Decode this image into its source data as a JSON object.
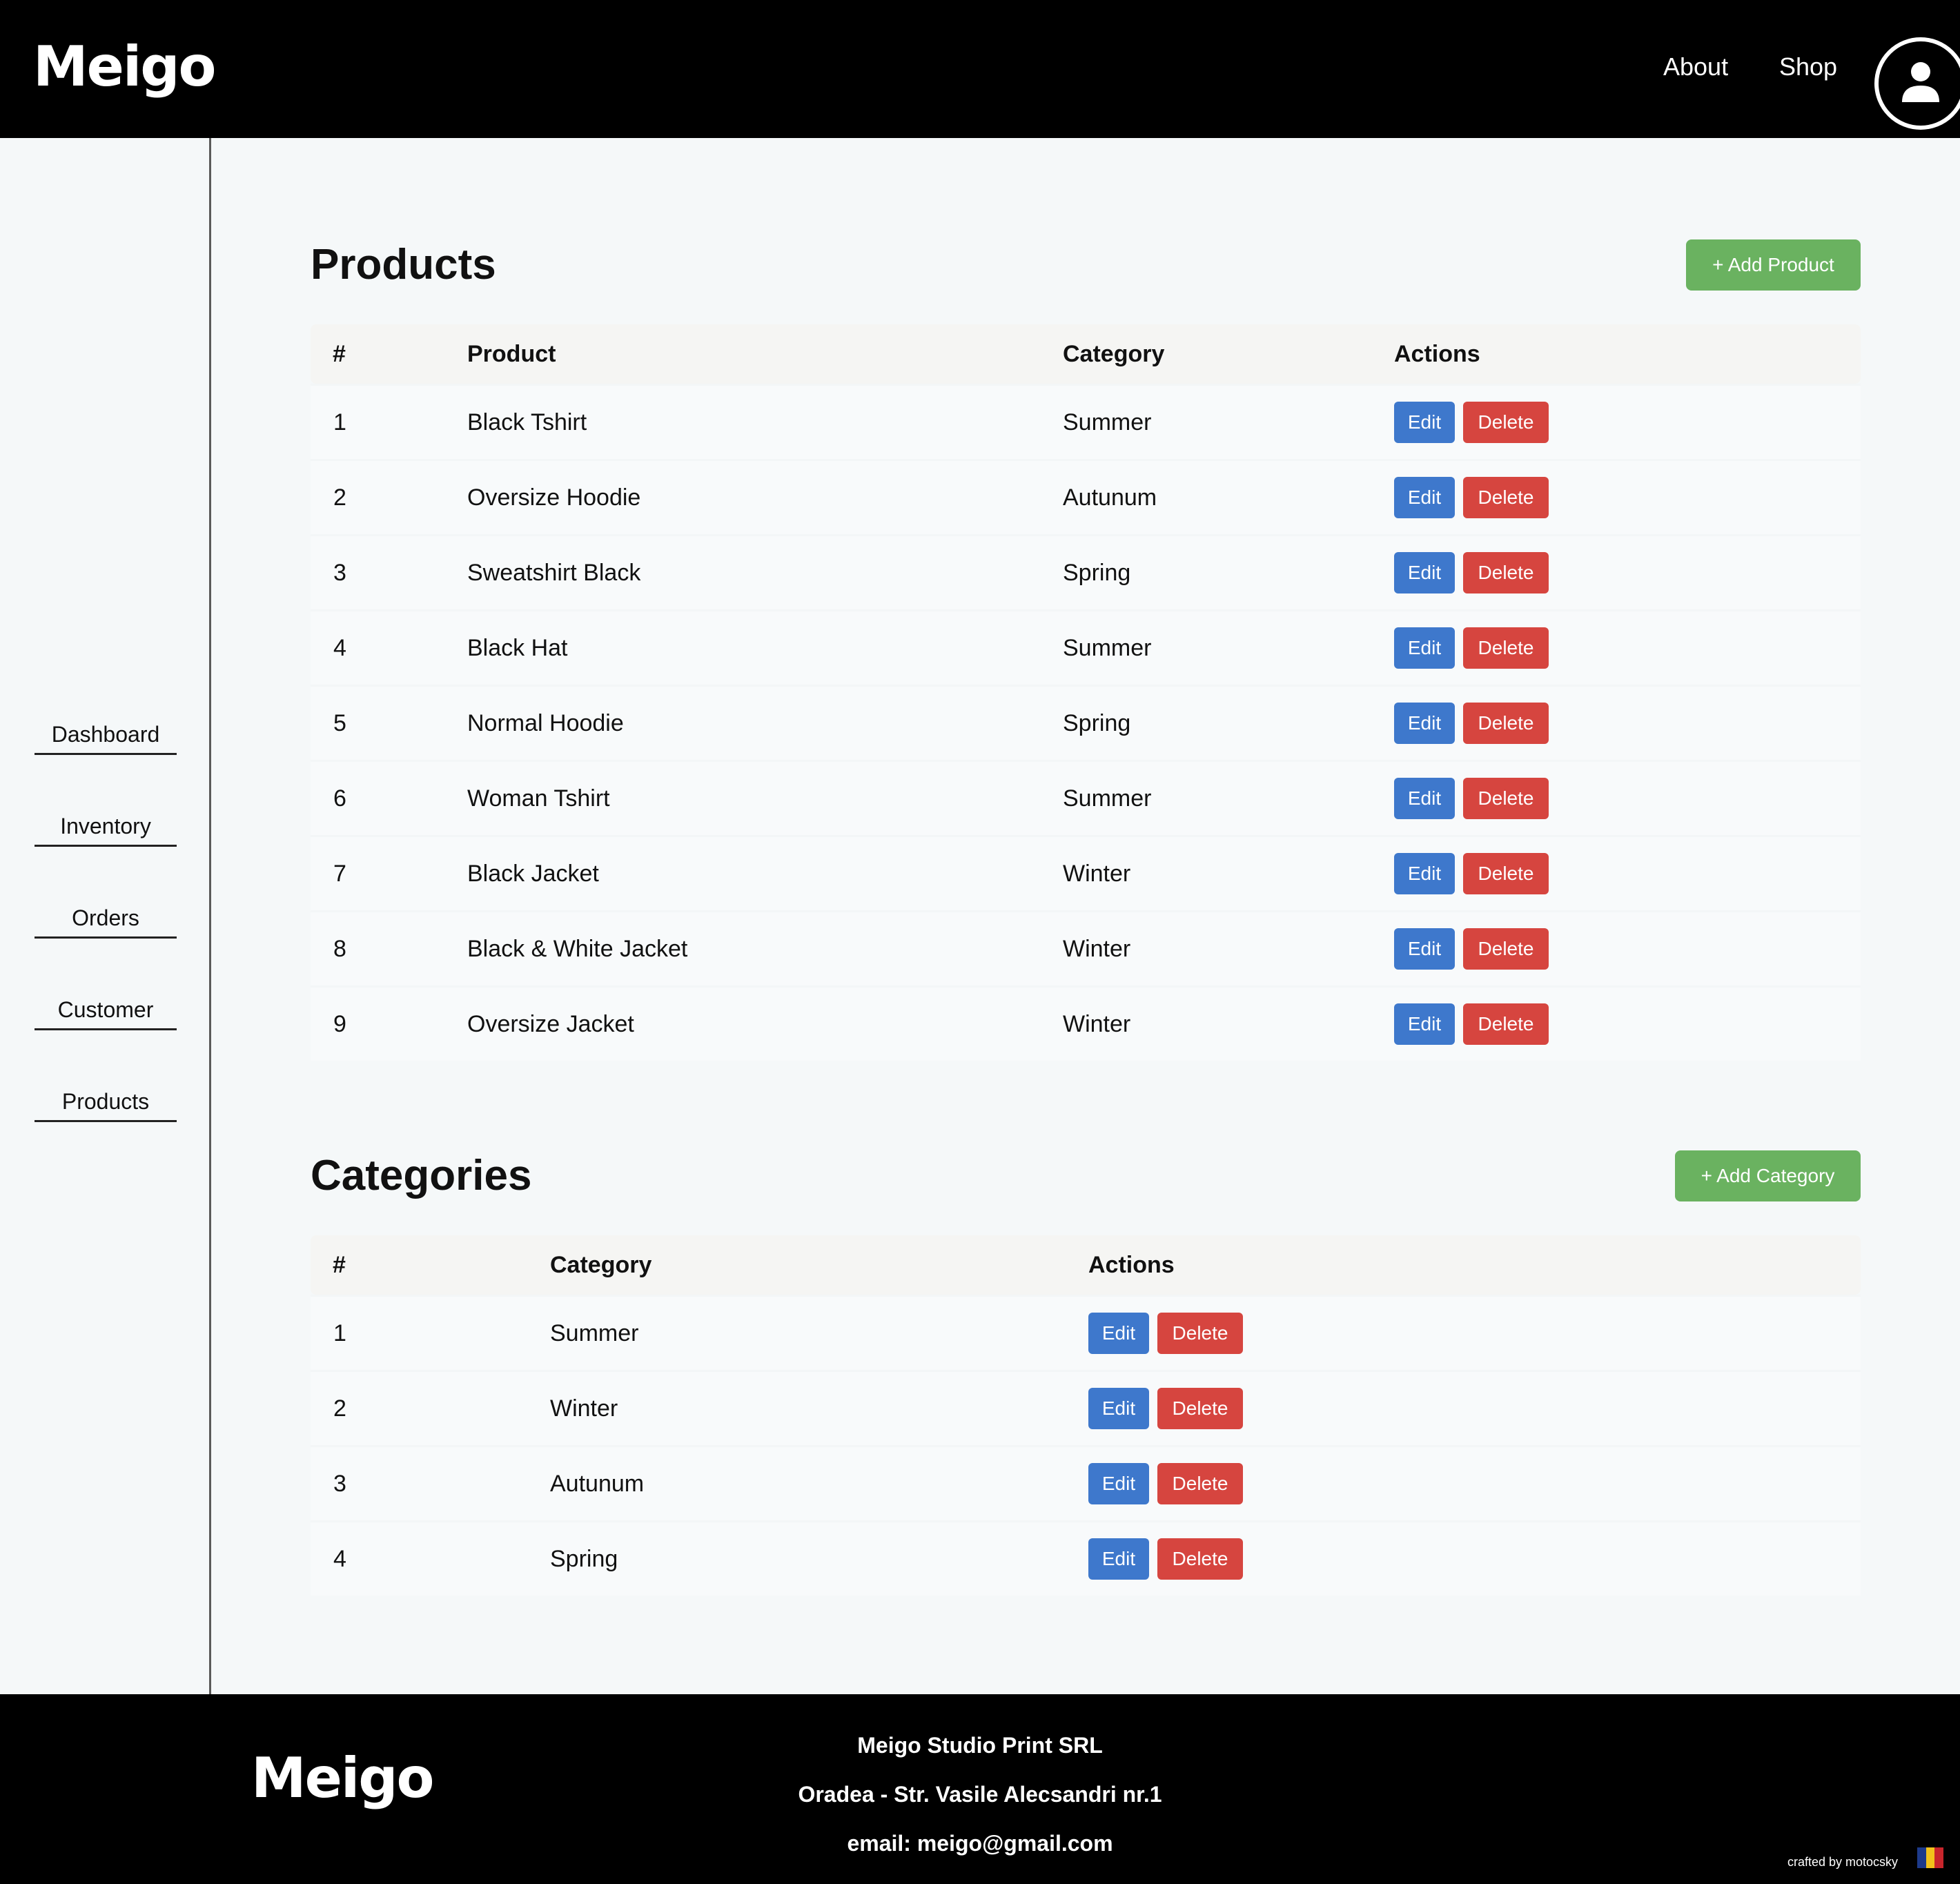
{
  "header": {
    "logo": "Meigo",
    "nav": {
      "about": "About",
      "shop": "Shop"
    }
  },
  "sidebar": {
    "items": [
      {
        "label": "Dashboard"
      },
      {
        "label": "Inventory"
      },
      {
        "label": "Orders"
      },
      {
        "label": "Customer"
      },
      {
        "label": "Products"
      }
    ]
  },
  "products": {
    "title": "Products",
    "add_label": "+ Add Product",
    "columns": [
      "#",
      "Product",
      "Category",
      "Actions"
    ],
    "rows": [
      {
        "id": "1",
        "product": "Black Tshirt",
        "category": "Summer"
      },
      {
        "id": "2",
        "product": "Oversize Hoodie",
        "category": "Autunum"
      },
      {
        "id": "3",
        "product": "Sweatshirt Black",
        "category": "Spring"
      },
      {
        "id": "4",
        "product": "Black Hat",
        "category": "Summer"
      },
      {
        "id": "5",
        "product": "Normal Hoodie",
        "category": "Spring"
      },
      {
        "id": "6",
        "product": "Woman Tshirt",
        "category": "Summer"
      },
      {
        "id": "7",
        "product": "Black Jacket",
        "category": "Winter"
      },
      {
        "id": "8",
        "product": "Black & White Jacket",
        "category": "Winter"
      },
      {
        "id": "9",
        "product": "Oversize Jacket",
        "category": "Winter"
      }
    ]
  },
  "categories": {
    "title": "Categories",
    "add_label": "+ Add Category",
    "columns": [
      "#",
      "Category",
      "Actions"
    ],
    "rows": [
      {
        "id": "1",
        "category": "Summer"
      },
      {
        "id": "2",
        "category": "Winter"
      },
      {
        "id": "3",
        "category": "Autunum"
      },
      {
        "id": "4",
        "category": "Spring"
      }
    ]
  },
  "actions": {
    "edit": "Edit",
    "delete": "Delete"
  },
  "footer": {
    "logo": "Meigo",
    "company": "Meigo Studio Print SRL",
    "address": "Oradea - Str. Vasile Alecsandri nr.1",
    "email": "email: meigo@gmail.com",
    "credit": "crafted by motocsky"
  },
  "colors": {
    "add_button": "#6ab260",
    "edit_button": "#3e78cc",
    "delete_button": "#d6453f",
    "flag": [
      "#1d3a8a",
      "#f2c21b",
      "#c8252c"
    ]
  }
}
